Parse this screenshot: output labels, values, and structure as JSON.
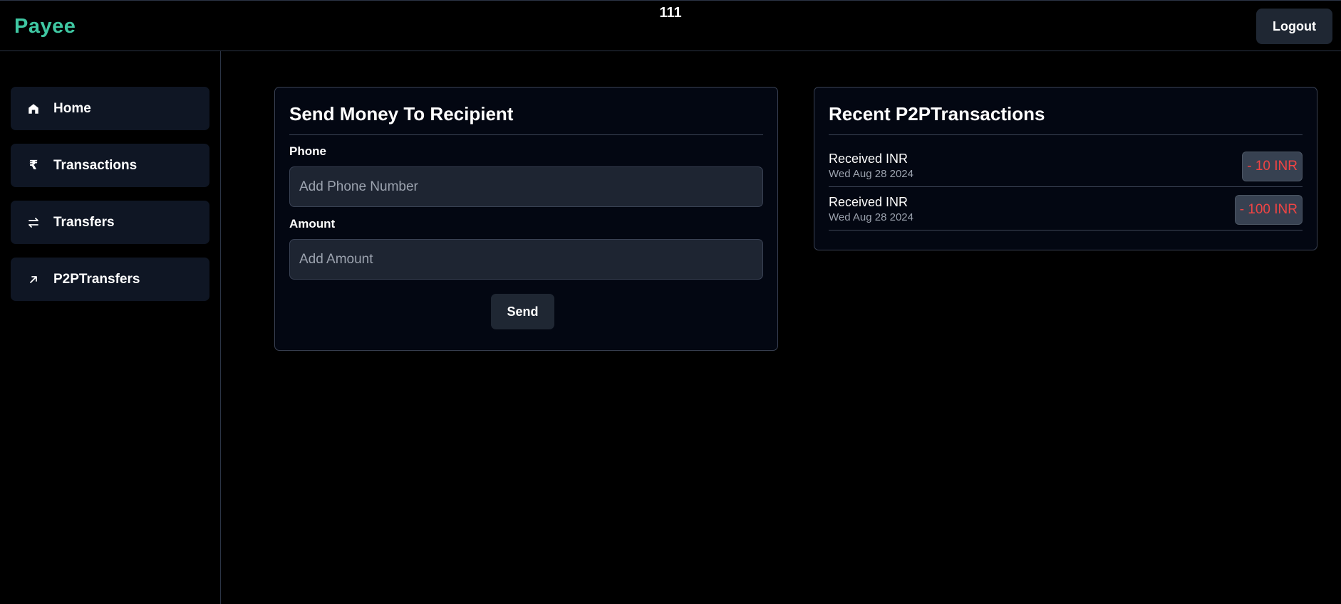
{
  "app": {
    "brand": "Payee",
    "top_center_text": "111",
    "logout_label": "Logout",
    "brand_color": "#3fc7a2"
  },
  "sidebar": {
    "items": [
      {
        "label": "Home",
        "icon": "home-icon"
      },
      {
        "label": "Transactions",
        "icon": "rupee-icon"
      },
      {
        "label": "Transfers",
        "icon": "swap-arrows-icon"
      },
      {
        "label": "P2PTransfers",
        "icon": "arrow-up-right-icon"
      }
    ]
  },
  "send_card": {
    "title": "Send Money To Recipient",
    "phone_label": "Phone",
    "phone_placeholder": "Add Phone Number",
    "phone_value": "",
    "amount_label": "Amount",
    "amount_placeholder": "Add Amount",
    "amount_value": "",
    "send_label": "Send"
  },
  "recent_card": {
    "title": "Recent P2PTransactions",
    "transactions": [
      {
        "title": "Received INR",
        "date": "Wed Aug 28 2024",
        "amount": "- 10 INR"
      },
      {
        "title": "Received INR",
        "date": "Wed Aug 28 2024",
        "amount": "- 100 INR"
      }
    ],
    "amount_color": "#ef4444"
  }
}
